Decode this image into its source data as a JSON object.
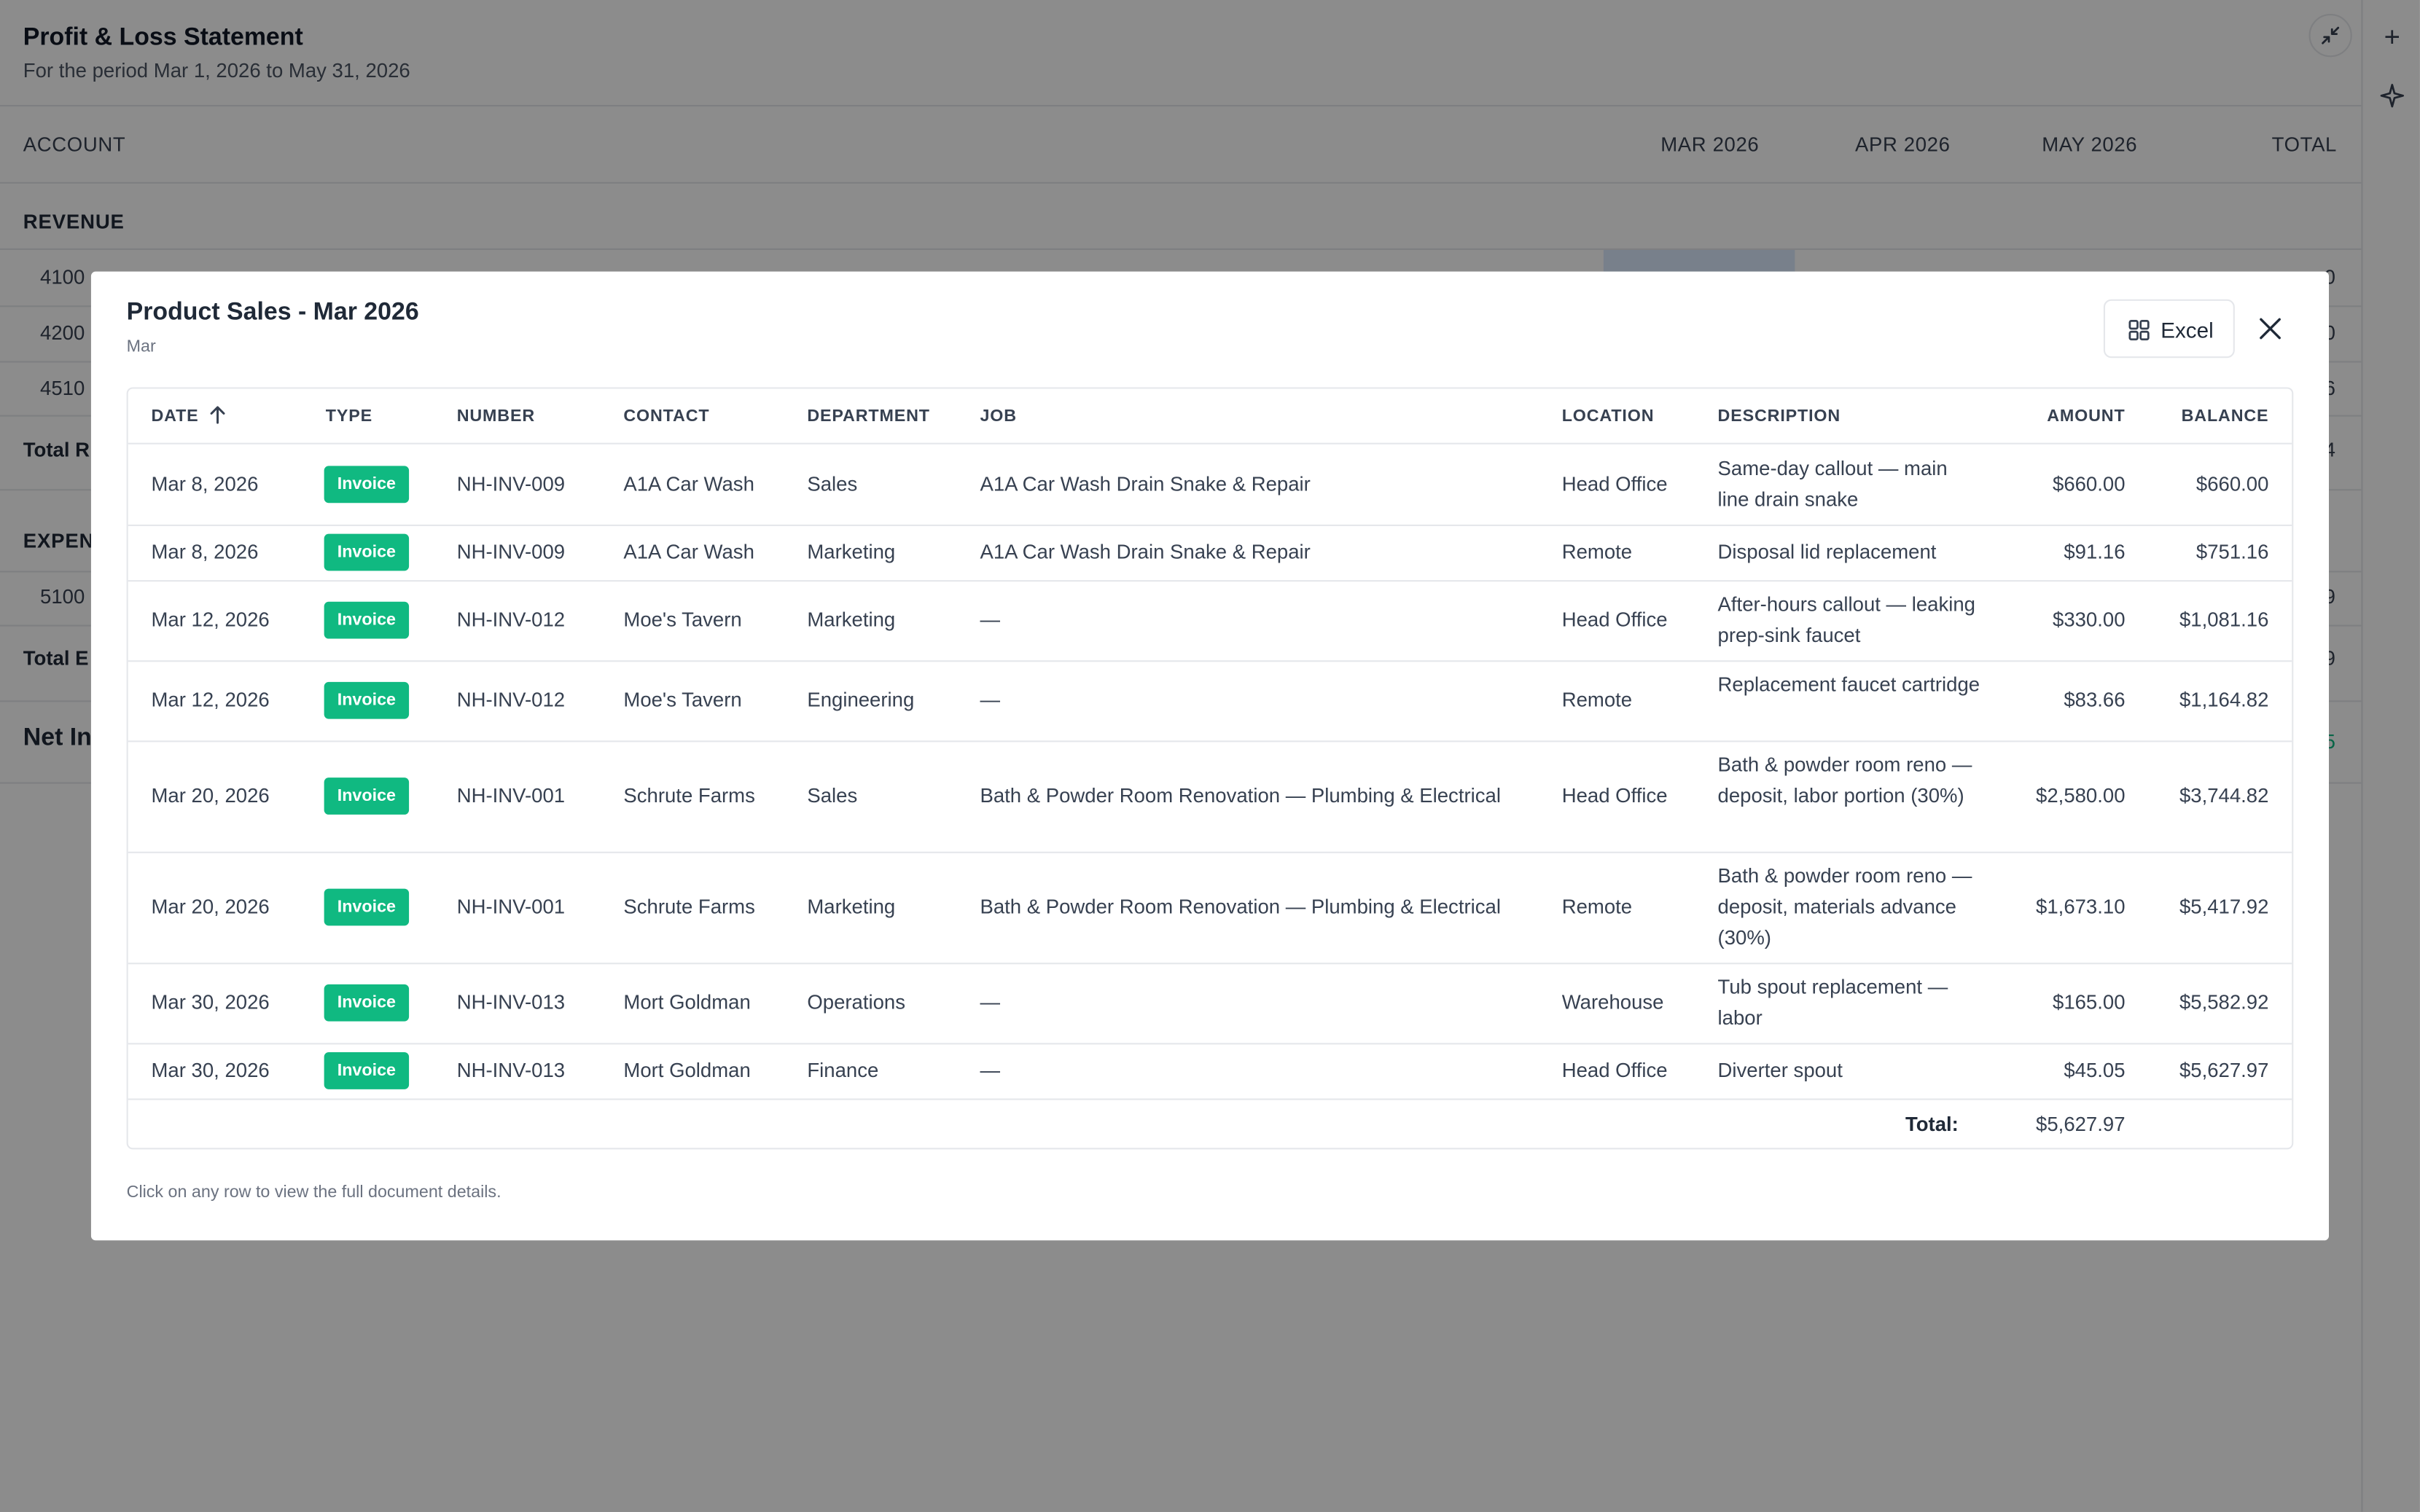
{
  "report": {
    "title": "Profit & Loss Statement",
    "period": "For the period Mar 1, 2026 to May 31, 2026",
    "columns": {
      "account": "ACCOUNT",
      "mar": "MAR 2026",
      "apr": "APR 2026",
      "may": "MAY 2026",
      "total": "TOTAL"
    },
    "revenue_label": "REVENUE",
    "revenue_rows": [
      "4100",
      "4200",
      "4510"
    ],
    "total_revenue_label": "Total R",
    "expense_label": "EXPEN",
    "expense_rows": [
      "5100"
    ],
    "total_expense_label": "Total E",
    "net_income_label": "Net In",
    "right_edge": [
      "0",
      "0",
      "6",
      "4",
      "9",
      "9",
      "5"
    ]
  },
  "modal": {
    "title": "Product Sales - Mar 2026",
    "subtitle": "Mar",
    "excel_label": "Excel",
    "headers": {
      "date": "DATE",
      "type": "TYPE",
      "number": "NUMBER",
      "contact": "CONTACT",
      "department": "DEPARTMENT",
      "job": "JOB",
      "location": "LOCATION",
      "description": "DESCRIPTION",
      "amount": "AMOUNT",
      "balance": "BALANCE"
    },
    "rows": [
      {
        "date": "Mar 8, 2026",
        "type": "Invoice",
        "number": "NH-INV-009",
        "contact": "A1A Car Wash",
        "department": "Sales",
        "job": "A1A Car Wash Drain Snake & Repair",
        "location": "Head Office",
        "description": "Same-day callout — main line drain snake",
        "amount": "$660.00",
        "balance": "$660.00"
      },
      {
        "date": "Mar 8, 2026",
        "type": "Invoice",
        "number": "NH-INV-009",
        "contact": "A1A Car Wash",
        "department": "Marketing",
        "job": "A1A Car Wash Drain Snake & Repair",
        "location": "Remote",
        "description": "Disposal lid replacement",
        "amount": "$91.16",
        "balance": "$751.16"
      },
      {
        "date": "Mar 12, 2026",
        "type": "Invoice",
        "number": "NH-INV-012",
        "contact": "Moe's Tavern",
        "department": "Marketing",
        "job": "—",
        "location": "Head Office",
        "description": "After-hours callout — leaking prep-sink faucet",
        "amount": "$330.00",
        "balance": "$1,081.16"
      },
      {
        "date": "Mar 12, 2026",
        "type": "Invoice",
        "number": "NH-INV-012",
        "contact": "Moe's Tavern",
        "department": "Engineering",
        "job": "—",
        "location": "Remote",
        "description": "Replacement faucet cartridge",
        "amount": "$83.66",
        "balance": "$1,164.82"
      },
      {
        "date": "Mar 20, 2026",
        "type": "Invoice",
        "number": "NH-INV-001",
        "contact": "Schrute Farms",
        "department": "Sales",
        "job": "Bath & Powder Room Renovation — Plumbing & Electrical",
        "location": "Head Office",
        "description": "Bath & powder room reno — deposit, labor portion (30%)",
        "amount": "$2,580.00",
        "balance": "$3,744.82"
      },
      {
        "date": "Mar 20, 2026",
        "type": "Invoice",
        "number": "NH-INV-001",
        "contact": "Schrute Farms",
        "department": "Marketing",
        "job": "Bath & Powder Room Renovation — Plumbing & Electrical",
        "location": "Remote",
        "description": "Bath & powder room reno — deposit, materials advance (30%)",
        "amount": "$1,673.10",
        "balance": "$5,417.92"
      },
      {
        "date": "Mar 30, 2026",
        "type": "Invoice",
        "number": "NH-INV-013",
        "contact": "Mort Goldman",
        "department": "Operations",
        "job": "—",
        "location": "Warehouse",
        "description": "Tub spout replacement — labor",
        "amount": "$165.00",
        "balance": "$5,582.92"
      },
      {
        "date": "Mar 30, 2026",
        "type": "Invoice",
        "number": "NH-INV-013",
        "contact": "Mort Goldman",
        "department": "Finance",
        "job": "—",
        "location": "Head Office",
        "description": "Diverter spout",
        "amount": "$45.05",
        "balance": "$5,627.97"
      }
    ],
    "total_label": "Total:",
    "total_amount": "$5,627.97",
    "footnote": "Click on any row to view the full document details.",
    "badge_color": "#10b981"
  }
}
